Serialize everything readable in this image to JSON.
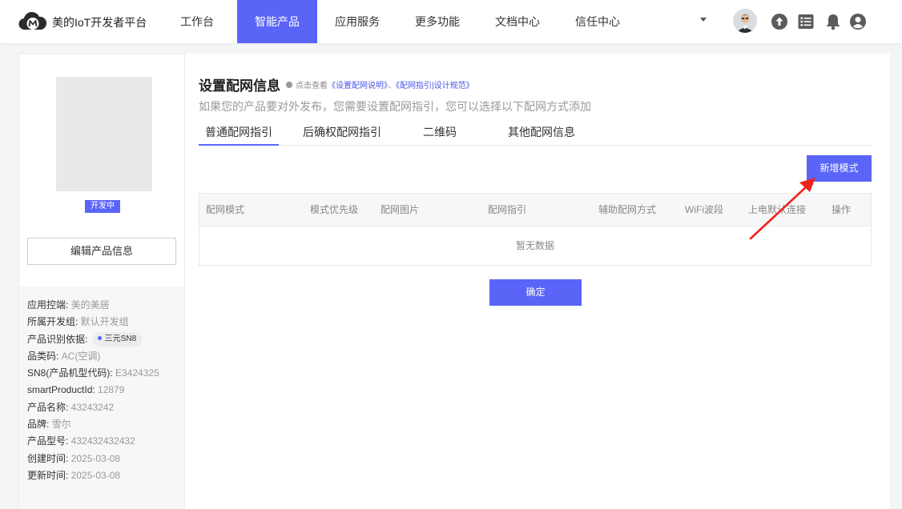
{
  "header": {
    "brand": "美的IoT开发者平台",
    "nav": [
      {
        "label": "工作台"
      },
      {
        "label": "智能产品"
      },
      {
        "label": "应用服务"
      },
      {
        "label": "更多功能"
      },
      {
        "label": "文档中心"
      },
      {
        "label": "信任中心"
      }
    ],
    "active_nav": "智能产品",
    "tools": [
      "upload-icon",
      "list-icon",
      "bell-icon",
      "user-icon"
    ]
  },
  "sidebar": {
    "status_badge": "开发中",
    "edit_button": "编辑产品信息",
    "info": [
      {
        "key": "应用控端: ",
        "value": "美的美居"
      },
      {
        "key": "所属开发组: ",
        "value": "默认开发组"
      },
      {
        "key": "产品识别依据: ",
        "chip": "三元SN8"
      },
      {
        "key": "品类码: ",
        "value": "AC(空调)"
      },
      {
        "key": "SN8(产品机型代码): ",
        "value": "E3424325"
      },
      {
        "key": "smartProductId: ",
        "value": "12879"
      },
      {
        "key": "产品名称: ",
        "value": "43243242"
      },
      {
        "key": "品牌: ",
        "value": "雪尔"
      },
      {
        "key": "产品型号: ",
        "value": "432432432432"
      },
      {
        "key": "创建时间: ",
        "value": "2025-03-08"
      },
      {
        "key": "更新时间: ",
        "value": "2025-03-08"
      }
    ]
  },
  "main": {
    "title": "设置配网信息",
    "hint_prefix": "点击查看",
    "hint_link1": "《设置配网说明》",
    "hint_sep": "、",
    "hint_link2": "《配网指引|设计规范》",
    "subtitle": "如果您的产品要对外发布，您需要设置配网指引，您可以选择以下配网方式添加",
    "tabs": [
      {
        "label": "普通配网指引"
      },
      {
        "label": "后确权配网指引"
      },
      {
        "label": "二维码"
      },
      {
        "label": "其他配网信息"
      }
    ],
    "active_tab": "普通配网指引",
    "add_button": "新增模式",
    "table": {
      "columns": [
        "配网模式",
        "模式优先级",
        "配网图片",
        "配网指引",
        "辅助配网方式",
        "WiFi波段",
        "上电默认连接",
        "操作"
      ],
      "empty_text": "暂无数据"
    },
    "confirm_button": "确定"
  },
  "colors": {
    "accent": "#5a65f8",
    "annotation_arrow": "#f0231c"
  }
}
